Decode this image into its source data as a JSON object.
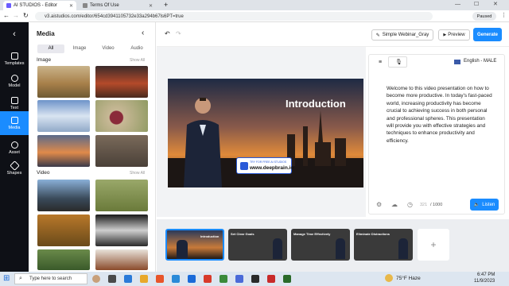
{
  "browser": {
    "tabs": [
      {
        "title": "AI STUDIOS - Editor"
      },
      {
        "title": "Terms Of Use"
      }
    ],
    "new_tab": "+",
    "url": "v3.aistudios.com/editor/654cd3941105732e33a294b67ls6PT=true",
    "profile": "Paused"
  },
  "nav": {
    "items": [
      {
        "label": "Templates"
      },
      {
        "label": "Model"
      },
      {
        "label": "Text"
      },
      {
        "label": "Media"
      },
      {
        "label": "Asset"
      },
      {
        "label": "Shapes"
      }
    ]
  },
  "media": {
    "title": "Media",
    "tabs": [
      "All",
      "Image",
      "Video",
      "Audio"
    ],
    "image_heading": "Image",
    "image_show_all": "Show All",
    "video_heading": "Video",
    "video_show_all": "Show All"
  },
  "toolbar": {
    "project_name": "Simple Webinar_Gray",
    "preview": "Preview",
    "generate": "Generate"
  },
  "slide": {
    "title": "Introduction",
    "badge_small": "TRY FOR FREE  AI STUDIOS",
    "badge_url": "www.deepbrain.io"
  },
  "script": {
    "language": "English - MALE",
    "text": "Welcome to this video presentation on how to become more productive. In today's fast-paced world, increasing productivity has become crucial to achieving success in both personal and professional spheres. This presentation will provide you with effective strategies and techniques to enhance productivity and efficiency.",
    "char_count": "321",
    "char_limit": "/ 1000",
    "listen": "Listen"
  },
  "timeline": {
    "scenes": [
      {
        "title": "Introduction"
      },
      {
        "title": "Set Clear Goals"
      },
      {
        "title": "Manage Time Effectively"
      },
      {
        "title": "Eliminate Distractions"
      }
    ],
    "add": "+"
  },
  "taskbar": {
    "search_placeholder": "Type here to search",
    "weather": "75°F  Haze",
    "time": "6:47 PM",
    "date": "11/9/2023"
  },
  "colors": {
    "accent": "#1a8cff",
    "nav_bg": "#0e1016"
  }
}
